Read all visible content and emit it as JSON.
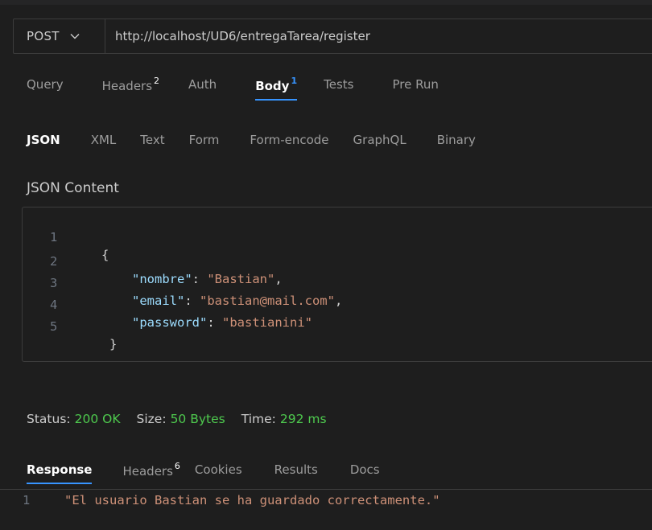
{
  "request": {
    "method": "POST",
    "url": "http://localhost/UD6/entregaTarea/register"
  },
  "request_tabs": [
    {
      "label": "Query",
      "badge": "",
      "active": false
    },
    {
      "label": "Headers",
      "badge": "2",
      "active": false
    },
    {
      "label": "Auth",
      "badge": "",
      "active": false
    },
    {
      "label": "Body",
      "badge": "1",
      "active": true
    },
    {
      "label": "Tests",
      "badge": "",
      "active": false
    },
    {
      "label": "Pre Run",
      "badge": "",
      "active": false
    }
  ],
  "body_tabs": [
    {
      "label": "JSON",
      "active": true
    },
    {
      "label": "XML",
      "active": false
    },
    {
      "label": "Text",
      "active": false
    },
    {
      "label": "Form",
      "active": false
    },
    {
      "label": "Form-encode",
      "active": false
    },
    {
      "label": "GraphQL",
      "active": false
    },
    {
      "label": "Binary",
      "active": false
    }
  ],
  "body_section_title": "JSON Content",
  "editor": {
    "line_numbers": [
      "1",
      "2",
      "3",
      "4",
      "5"
    ],
    "open_brace": "{",
    "close_brace": "}",
    "fields": [
      {
        "key": "\"nombre\"",
        "value": "\"Bastian\"",
        "trailing": ","
      },
      {
        "key": "\"email\"",
        "value": "\"bastian@mail.com\"",
        "trailing": ","
      },
      {
        "key": "\"password\"",
        "value": "\"bastianini\"",
        "trailing": ""
      }
    ]
  },
  "status": {
    "status_label": "Status:",
    "status_value": "200 OK",
    "size_label": "Size:",
    "size_value": "50 Bytes",
    "time_label": "Time:",
    "time_value": "292 ms"
  },
  "response_tabs": [
    {
      "label": "Response",
      "badge": "",
      "active": true
    },
    {
      "label": "Headers",
      "badge": "6",
      "active": false
    },
    {
      "label": "Cookies",
      "badge": "",
      "active": false
    },
    {
      "label": "Results",
      "badge": "",
      "active": false
    },
    {
      "label": "Docs",
      "badge": "",
      "active": false
    }
  ],
  "response": {
    "line_number": "1",
    "text": "\"El usuario Bastian se ha guardado correctamente.\""
  },
  "colors": {
    "accent": "#3794ff",
    "status_ok": "#4ec94e",
    "json_key": "#9cdcfe",
    "json_string": "#ce9178"
  }
}
